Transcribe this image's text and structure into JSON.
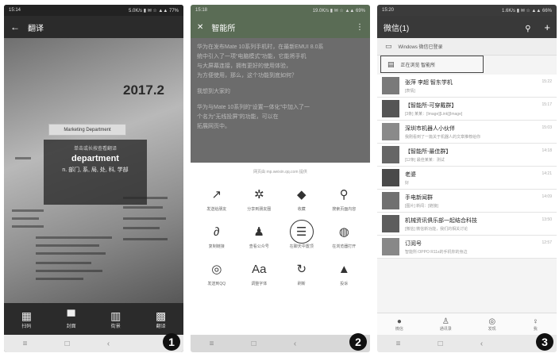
{
  "panels": [
    {
      "status_time": "15:14",
      "status_right": "5.0K/s ▮ ✉ ☆ ▲▲ 77%",
      "title": "翻译",
      "back": "←",
      "year": "2017.2",
      "marketing": "Marketing Department",
      "card_hint": "单击或长按查看翻译",
      "word": "department",
      "meaning": "n. 部门, 系, 局, 处, 科, 学部",
      "tabs": [
        {
          "icon": "▦",
          "label": "扫码"
        },
        {
          "icon": "▀",
          "label": "封面"
        },
        {
          "icon": "▥",
          "label": "街景"
        },
        {
          "icon": "▩",
          "label": "翻译"
        }
      ],
      "badge": "1"
    },
    {
      "status_time": "15:18",
      "status_right": "19.0K/s ▮ ✉ ☆ ▲▲ 69%",
      "title": "智能所",
      "close": "✕",
      "menu": "⋮",
      "article": [
        "华为在发布Mate 10系列手机时，在最新EMUI 8.0系",
        "统中引入了一项“电脑模式”功能，它能将手机",
        "与大屏幕连接，拥有更好的使用体验，",
        "为方便使用，那么，这个功能到底如何？",
        "我想到大家的",
        "华为与Mate 10系列的“设置一体化”中加入了一",
        "个名为“无线投屏”的功能，可以在",
        "拓展网页中。"
      ],
      "url": "网页由 mp.weixin.qq.com 提供",
      "actions": [
        {
          "icon": "↗",
          "label": "发送给朋友"
        },
        {
          "icon": "✲",
          "label": "分享到朋友圈"
        },
        {
          "icon": "◆",
          "label": "收藏"
        },
        {
          "icon": "⚲",
          "label": "搜索页面内容"
        },
        {
          "icon": "∂",
          "label": "复制链接"
        },
        {
          "icon": "♟",
          "label": "查看公众号"
        },
        {
          "icon": "☰",
          "label": "在聊天中置顶"
        },
        {
          "icon": "◍",
          "label": "在浏览器打开"
        },
        {
          "icon": "◎",
          "label": "发送到QQ"
        },
        {
          "icon": "Aa",
          "label": "调整字体"
        },
        {
          "icon": "↻",
          "label": "刷新"
        },
        {
          "icon": "▲",
          "label": "投诉"
        }
      ],
      "badge": "2"
    },
    {
      "status_time": "15:20",
      "status_right": "1.6K/s ▮ ✉ ☆ ▲▲ 66%",
      "title": "微信(1)",
      "search": "⚲",
      "add": "+",
      "notice": "Windows 微信已登录",
      "viewing": "正在浏览 智能所",
      "chats": [
        {
          "name": "张萍 李超 智东学机",
          "preview": "[表情]",
          "time": "15:22"
        },
        {
          "name": "【智能所-可穿戴群】",
          "preview": "[3条] 某某：[Image][Link][Image]",
          "time": "15:17"
        },
        {
          "name": "深圳市机器人小伙伴",
          "preview": "我刚看到了一篇关于机器人的文章推荐给你",
          "time": "15:03"
        },
        {
          "name": "【智能所-最佳群】",
          "preview": "[12条] 最佳某某：测试",
          "time": "14:18"
        },
        {
          "name": "老婆",
          "preview": "好",
          "time": "14:21"
        },
        {
          "name": "手电新闻群",
          "preview": "[图片] 新闻：[链接]",
          "time": "14:09"
        },
        {
          "name": "机械资讯俱乐部一起结合科技",
          "preview": "[微信] 微信新功能，我们的相关讨论",
          "time": "13:50"
        },
        {
          "name": "订阅号",
          "preview": "智能所:OPPO R11s的手机你的身边",
          "time": "12:57"
        }
      ],
      "tabs": [
        {
          "icon": "●",
          "label": "微信"
        },
        {
          "icon": "♙",
          "label": "通讯录"
        },
        {
          "icon": "◎",
          "label": "发现"
        },
        {
          "icon": "♀",
          "label": "我"
        }
      ],
      "badge": "3"
    }
  ],
  "nav": {
    "menu": "≡",
    "home": "□",
    "back": "‹"
  }
}
